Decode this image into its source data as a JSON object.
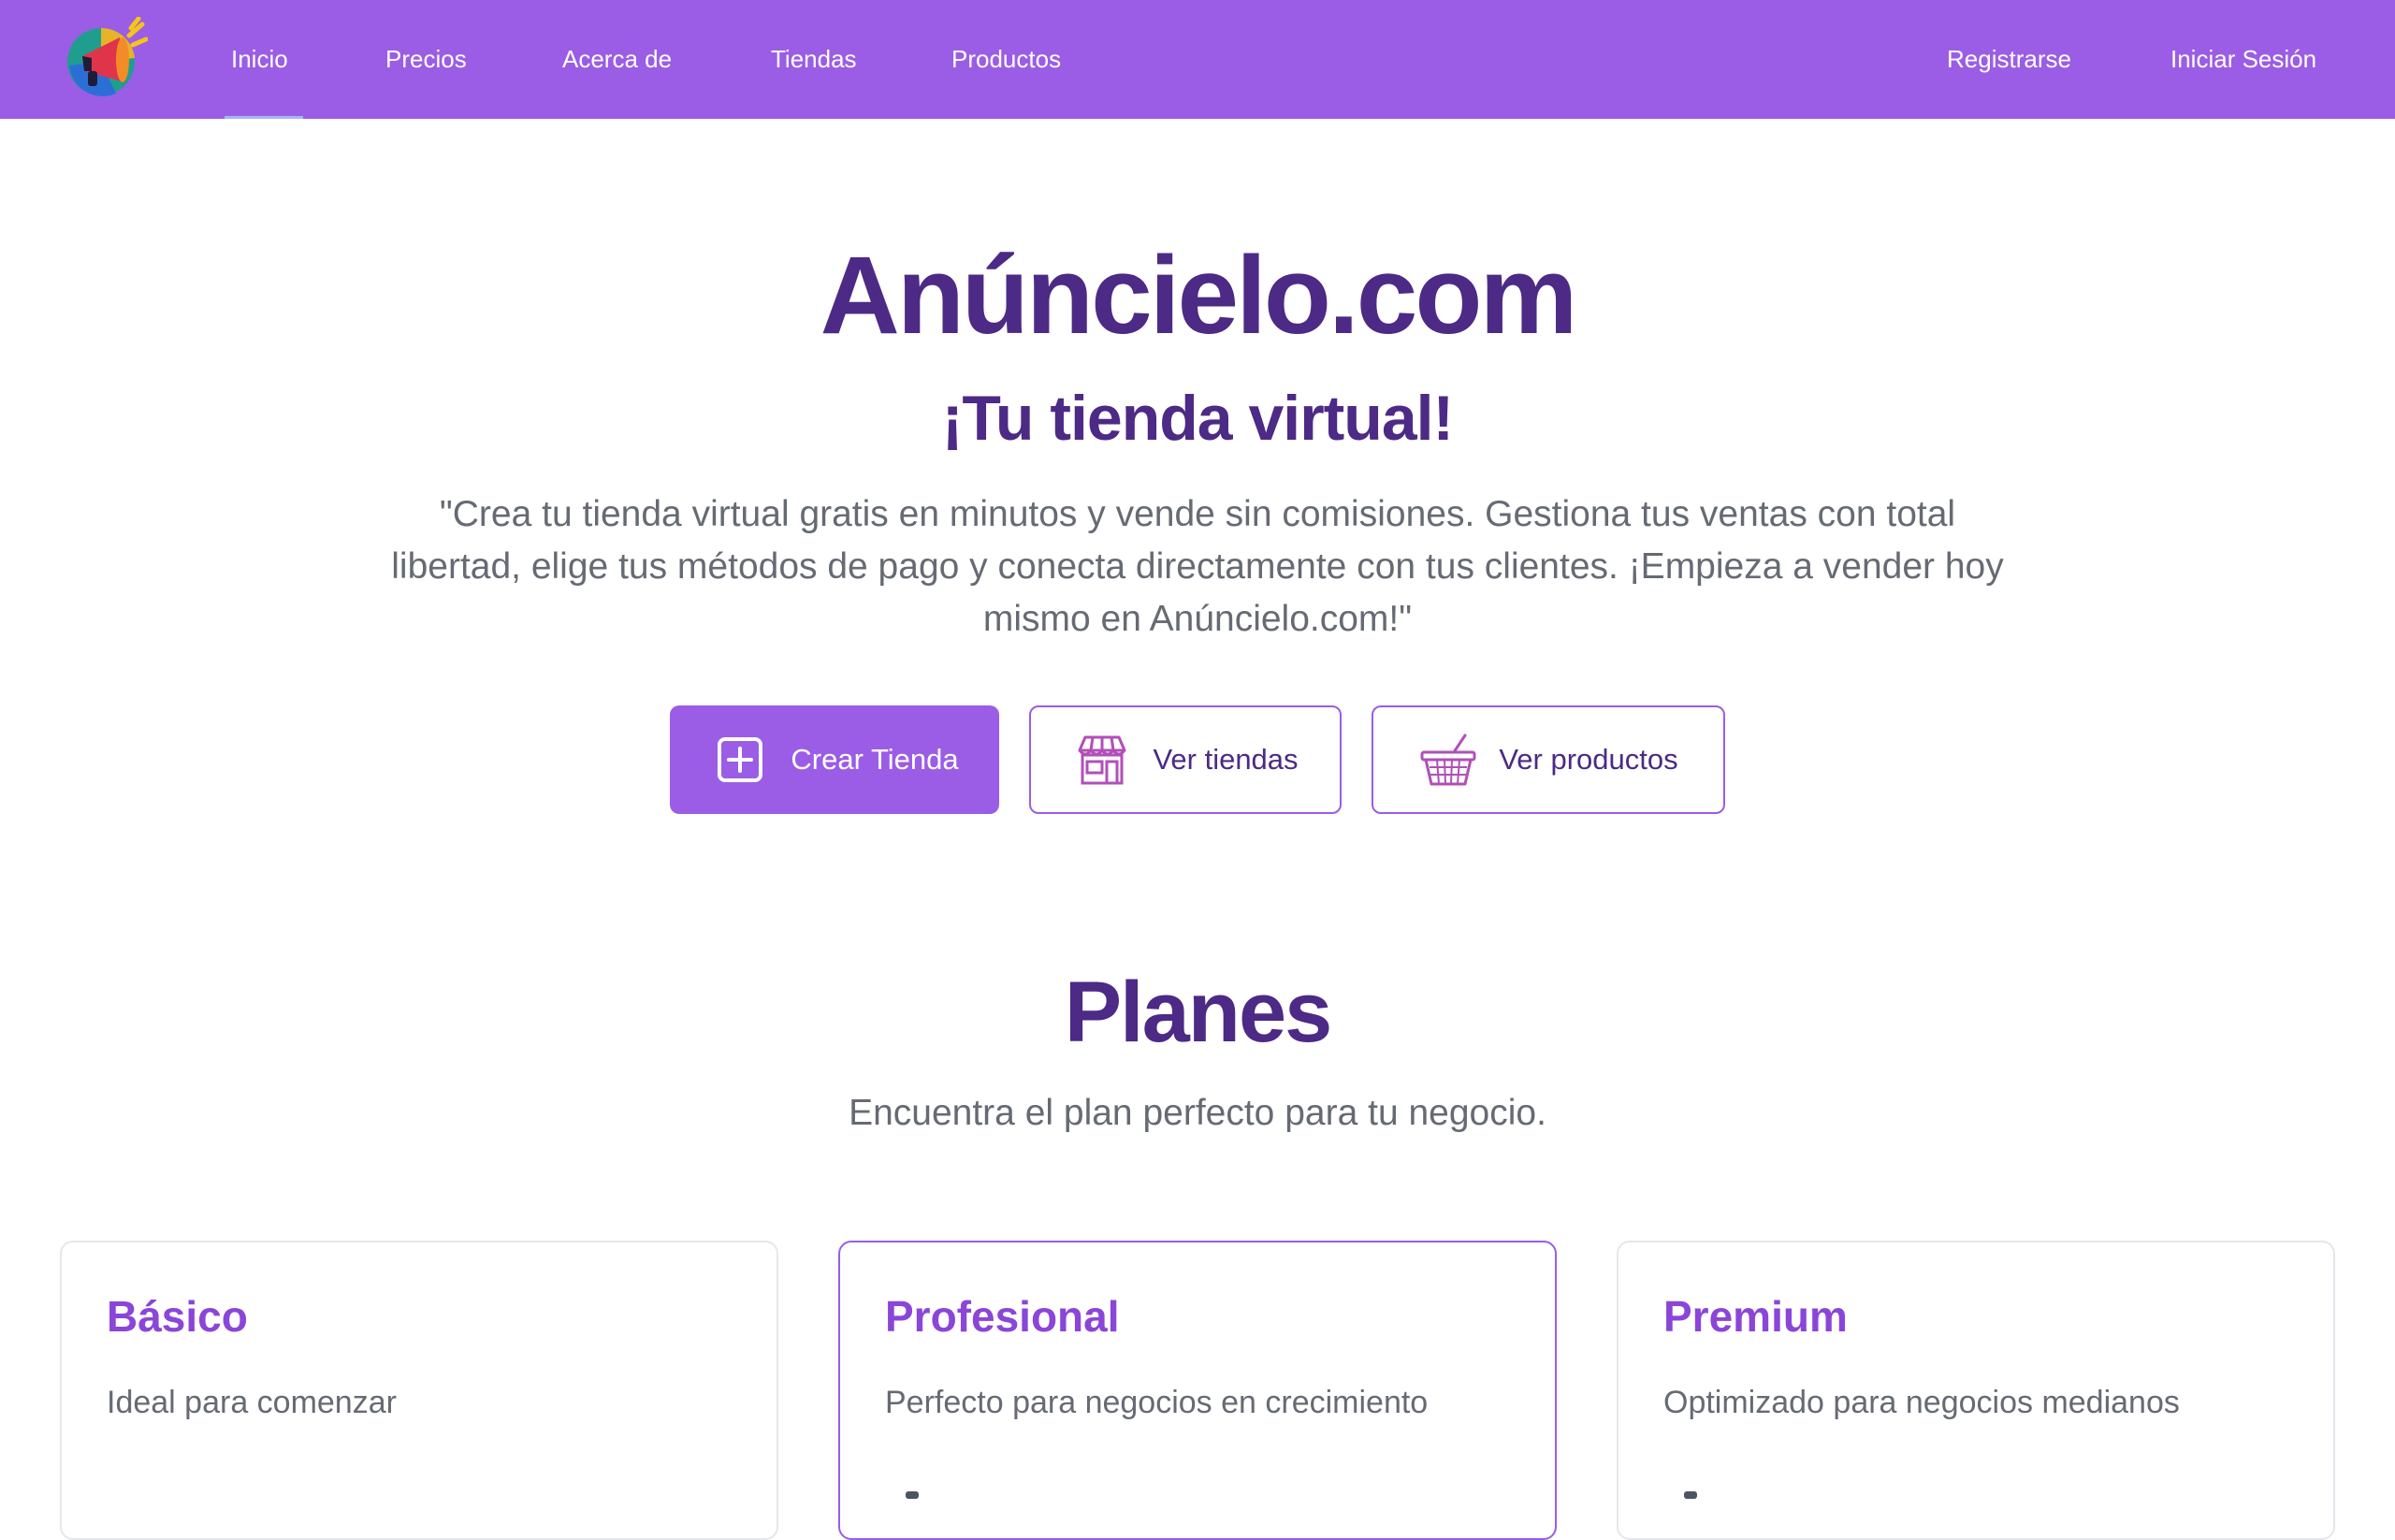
{
  "nav": {
    "logo_icon": "megaphone-logo-icon",
    "links": [
      "Inicio",
      "Precios",
      "Acerca de",
      "Tiendas",
      "Productos"
    ],
    "active": "Inicio",
    "register": "Registrarse",
    "login": "Iniciar Sesión"
  },
  "hero": {
    "title": "Anúncielo.com",
    "subtitle": "¡Tu tienda virtual!",
    "description": "\"Crea tu tienda virtual gratis en minutos y vende sin comisiones. Gestiona tus ventas con total libertad, elige tus métodos de pago y conecta directamente con tus clientes. ¡Empieza a vender hoy mismo en Anúncielo.com!\"",
    "buttons": {
      "create_store": "Crear Tienda",
      "view_stores": "Ver tiendas",
      "view_products": "Ver productos"
    }
  },
  "plans": {
    "title": "Planes",
    "subtitle": "Encuentra el plan perfecto para tu negocio.",
    "cards": [
      {
        "name": "Básico",
        "description": "Ideal para comenzar"
      },
      {
        "name": "Profesional",
        "description": "Perfecto para negocios en crecimiento"
      },
      {
        "name": "Premium",
        "description": "Optimizado para negocios medianos"
      }
    ]
  },
  "colors": {
    "brand": "#9b5de5",
    "heading": "#4c2a85",
    "muted_text": "#666a73",
    "card_title": "#8b45d8"
  },
  "icons": {
    "create_store": "plus-square-icon",
    "view_stores": "storefront-icon",
    "view_products": "shopping-basket-icon"
  }
}
